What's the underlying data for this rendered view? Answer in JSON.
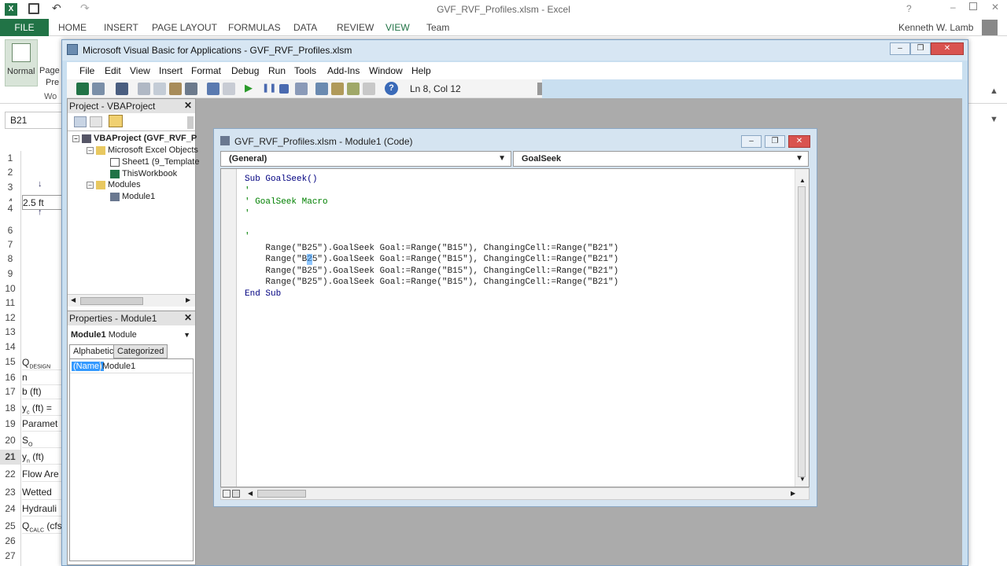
{
  "excel": {
    "title": "GVF_RVF_Profiles.xlsm - Excel",
    "file_tab": "FILE",
    "tabs": [
      "HOME",
      "INSERT",
      "PAGE LAYOUT",
      "FORMULAS",
      "DATA",
      "REVIEW",
      "VIEW",
      "Team"
    ],
    "user": "Kenneth W. Lamb",
    "ribbon_normal": "Normal",
    "ribbon_page": "Page",
    "ribbon_pre": "Pre",
    "ribbon_wor": "Wo",
    "name_box": "B21",
    "rows": [
      "1",
      "2",
      "3",
      "4",
      "5",
      "6",
      "7",
      "8",
      "9",
      "10",
      "11",
      "12",
      "13",
      "14",
      "15",
      "16",
      "17",
      "18",
      "19",
      "20",
      "21",
      "22",
      "23",
      "24",
      "25",
      "26",
      "27"
    ],
    "selected_row": "21",
    "dimension_label": "2.5 ft",
    "cells": {
      "r15": "Q",
      "r15_sub": "DESIGN",
      "r16": "n",
      "r17": "b (ft)",
      "r18": "y",
      "r18_sub": "c",
      "r18_rest": " (ft) =",
      "r19": "Paramet",
      "r20": "S",
      "r20_sub": "O",
      "r21": "y",
      "r21_sub": "n",
      "r21_rest": " (ft)",
      "r22": "Flow Are",
      "r23": "Wetted",
      "r24": "Hydrauli",
      "r25": "Q",
      "r25_sub": "CALC",
      "r25_rest": " (cfs"
    }
  },
  "vbe": {
    "title": "Microsoft Visual Basic for Applications - GVF_RVF_Profiles.xlsm",
    "menu": [
      "File",
      "Edit",
      "View",
      "Insert",
      "Format",
      "Debug",
      "Run",
      "Tools",
      "Add-Ins",
      "Window",
      "Help"
    ],
    "status_position": "Ln 8, Col 12",
    "project_pane_title": "Project - VBAProject",
    "tree": {
      "root": "VBAProject (GVF_RVF_P",
      "excel_objects": "Microsoft Excel Objects",
      "sheet1": "Sheet1 (9_Template",
      "thisworkbook": "ThisWorkbook",
      "modules": "Modules",
      "module1": "Module1"
    },
    "properties_pane_title": "Properties - Module1",
    "properties_object": "Module1",
    "properties_object_type": "Module",
    "properties_tab_alpha": "Alphabetic",
    "properties_tab_cat": "Categorized",
    "prop_name_key": "(Name)",
    "prop_name_value": "Module1"
  },
  "code_window": {
    "title": "GVF_RVF_Profiles.xlsm - Module1 (Code)",
    "object_combo": "(General)",
    "proc_combo": "GoalSeek",
    "lines": [
      "Sub GoalSeek()",
      "'",
      "' GoalSeek Macro",
      "'",
      "",
      "'",
      "    Range(\"B25\").GoalSeek Goal:=Range(\"B15\"), ChangingCell:=Range(\"B21\")",
      "    Range(\"B25\").GoalSeek Goal:=Range(\"B15\"), ChangingCell:=Range(\"B21\")",
      "    Range(\"B25\").GoalSeek Goal:=Range(\"B15\"), ChangingCell:=Range(\"B21\")",
      "    Range(\"B25\").GoalSeek Goal:=Range(\"B15\"), ChangingCell:=Range(\"B21\")",
      "End Sub"
    ]
  },
  "icons": {
    "excel_logo": "excel-logo-icon",
    "save": "save-icon",
    "run": "run-icon",
    "help": "help-icon"
  },
  "colors": {
    "excel_green": "#217346",
    "vbe_frame": "#c9dff0",
    "comment_green": "#008000"
  }
}
